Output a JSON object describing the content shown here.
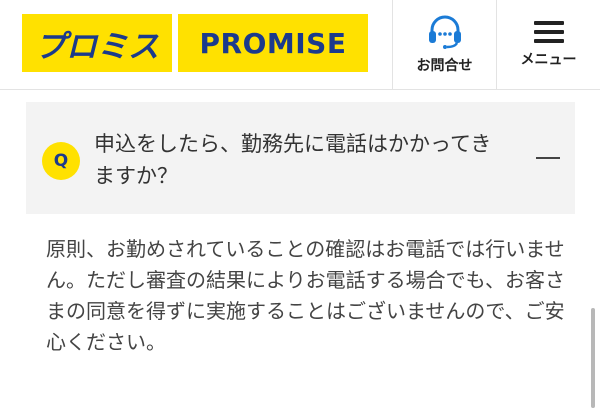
{
  "header": {
    "logo_jp": "プロミス",
    "logo_en": "PROMISE",
    "contact_label": "お問合せ",
    "menu_label": "メニュー"
  },
  "faq": {
    "badge": "Q",
    "question_line1": "申込をしたら、勤務先に電話はかかってき",
    "question_line2": "ますか？",
    "answer": "原則、お勤めされていることの確認はお電話では行いません。ただし審査の結果によりお電話する場合でも、お客さまの同意を得ずに実施することはございませんので、ご安心ください。"
  },
  "colors": {
    "brand_yellow": "#ffe100",
    "brand_navy": "#1b3a8c",
    "question_bg": "#f3f3f3"
  },
  "icons": {
    "contact": "headset-icon",
    "menu": "hamburger-menu-icon",
    "collapse": "minus-icon"
  }
}
